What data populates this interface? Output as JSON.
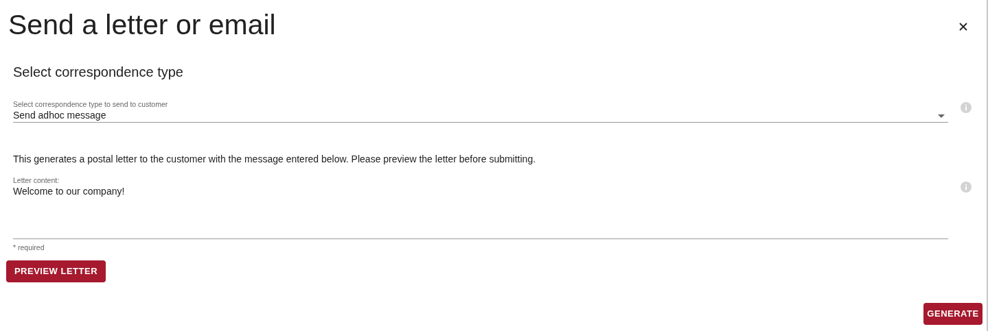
{
  "dialog": {
    "title": "Send a letter or email"
  },
  "section": {
    "title": "Select correspondence type"
  },
  "type_select": {
    "label": "Select correspondence type to send to customer",
    "value": "Send adhoc message"
  },
  "description": "This generates a postal letter to the customer with the message entered below. Please preview the letter before submitting.",
  "letter_field": {
    "label": "Letter content:",
    "value": "Welcome to our company!",
    "helper": "* required"
  },
  "buttons": {
    "preview": "PREVIEW LETTER",
    "generate": "GENERATE"
  }
}
